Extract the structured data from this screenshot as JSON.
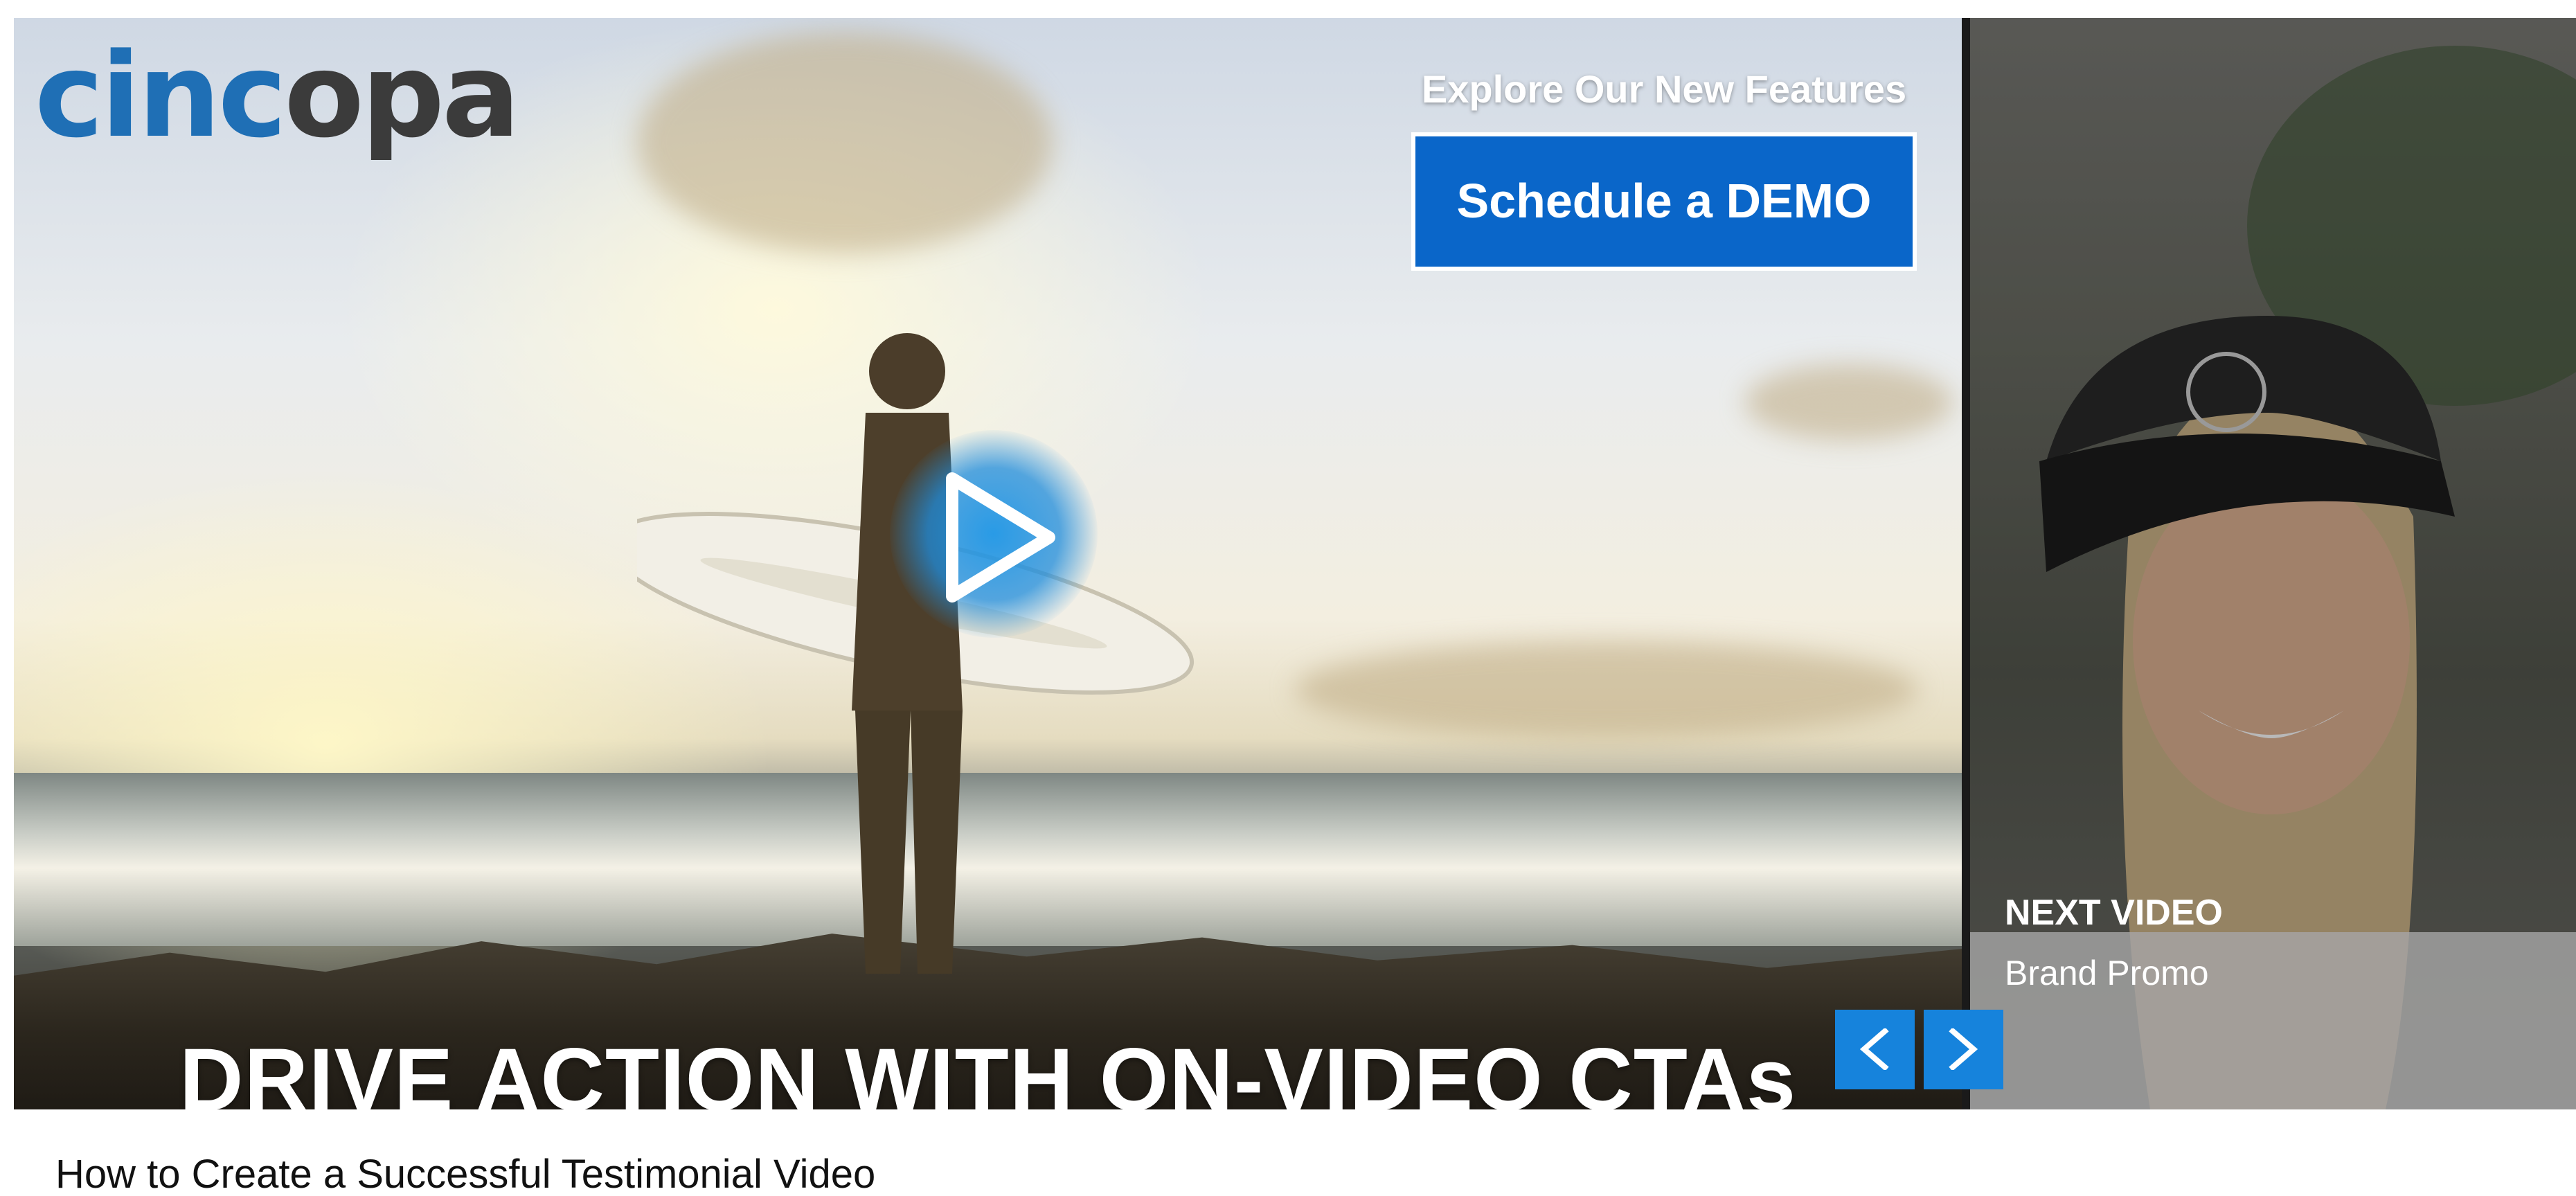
{
  "brand": {
    "logo_part1": "cinc",
    "logo_part2": "o",
    "logo_part3": "pa",
    "primary_color": "#1f6fb5",
    "secondary_color": "#3b3b3b"
  },
  "player": {
    "cta_title": "Explore Our New Features",
    "cta_button_label": "Schedule a DEMO",
    "cta_button_color": "#0a66c9",
    "headline": "DRIVE ACTION WITH ON-VIDEO CTAs",
    "play_icon": "play-icon"
  },
  "next_video": {
    "label": "NEXT VIDEO",
    "title": "Brand Promo",
    "prev_icon": "chevron-left-icon",
    "next_icon": "chevron-right-icon",
    "button_color": "#1683dc"
  },
  "caption": {
    "text": "How to Create a Successful Testimonial Video"
  }
}
